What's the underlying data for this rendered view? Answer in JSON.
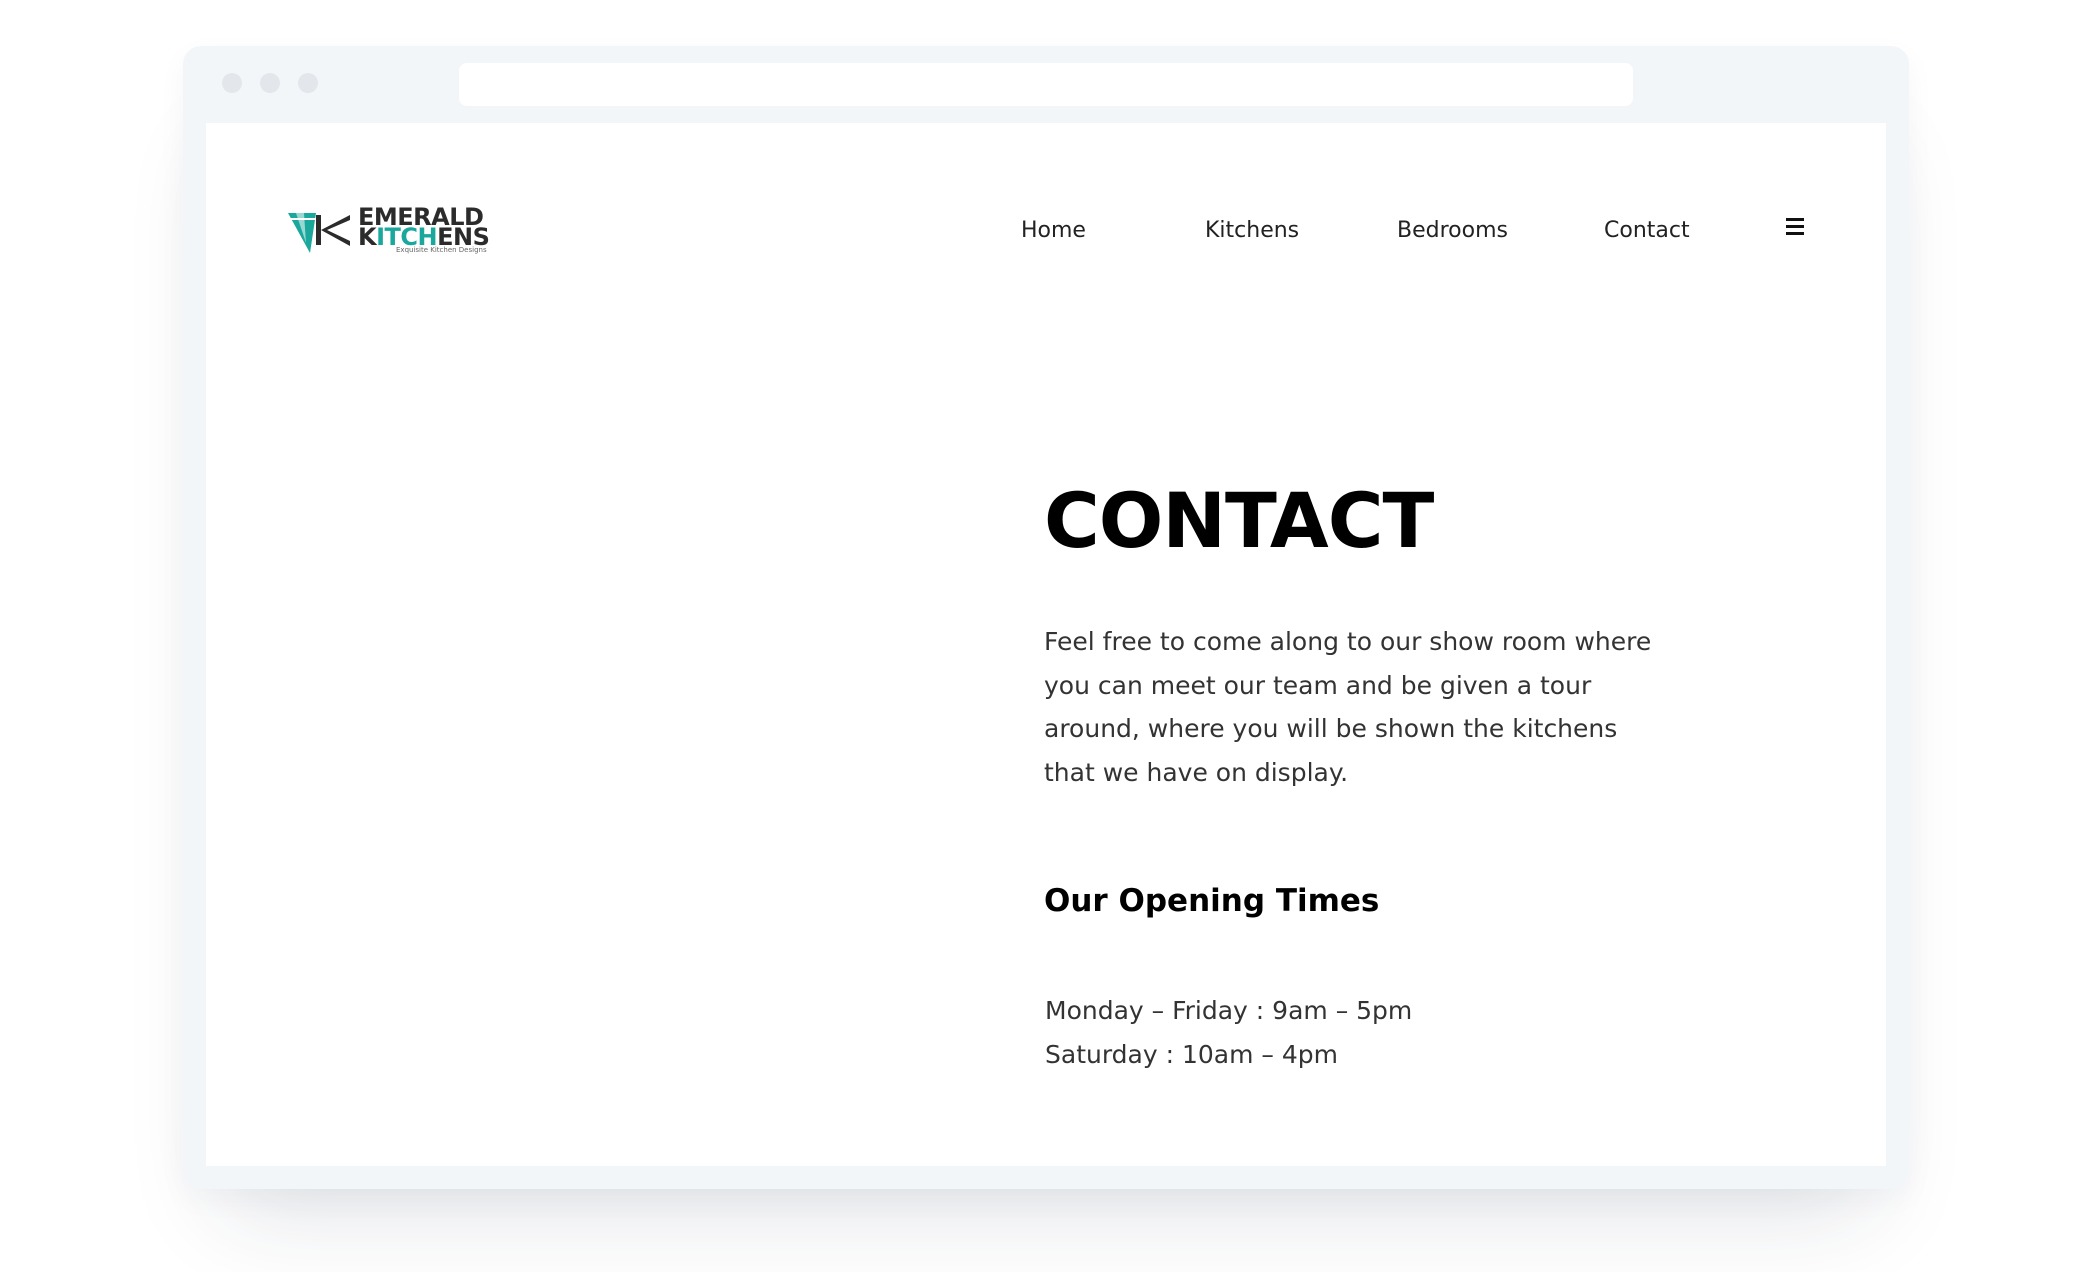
{
  "brand": {
    "line1": "EMERALD",
    "line2_prefix": "K",
    "line2_teal": "ITCH",
    "line2_suffix": "ENS",
    "tagline": "Exquisite Kitchen Designs",
    "accent_color": "#1aa89c",
    "text_color": "#2b2b2b"
  },
  "nav": {
    "items": [
      {
        "label": "Home"
      },
      {
        "label": "Kitchens"
      },
      {
        "label": "Bedrooms"
      },
      {
        "label": "Contact"
      }
    ],
    "menu_icon": "hamburger-icon"
  },
  "main": {
    "title": "CONTACT",
    "intro": "Feel free to come along to our show room where you can meet our team and be given a tour around, where you will be shown the kitchens that we have on display.",
    "opening_heading": "Our Opening Times",
    "hours": [
      "Monday – Friday : 9am – 5pm",
      "Saturday : 10am – 4pm"
    ]
  }
}
